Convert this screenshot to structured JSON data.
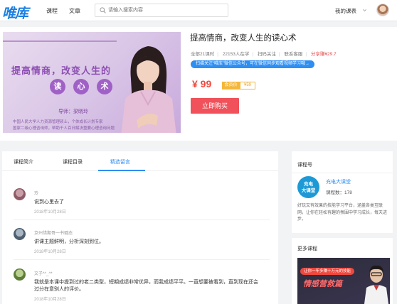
{
  "header": {
    "logo": "唯库",
    "nav": [
      "课程",
      "文章"
    ],
    "search_placeholder": "请输入搜索内容",
    "my_courses": "我的课表"
  },
  "course": {
    "cover": {
      "title_line": "提高情商，改变人生的",
      "circle_chars": [
        "读",
        "心",
        "术"
      ],
      "mentor": "导师：梁晓玲",
      "desc1": "中国人民大学人力资源管理硕士，个体成长计划专家",
      "desc2": "国家二级心理咨询师，帮助千人百日解决重要心理咨询问题"
    },
    "title": "提高情商，改变人生的读心术",
    "meta": {
      "lessons": "全部21课时",
      "learners": "22153人在学",
      "follow": "扫码关注",
      "service": "联系客服",
      "share": "分享赚¥29.7"
    },
    "promo": "扫描关注“唯库”微信公众号，可在微信同步观看视频学习哦→",
    "price": "¥ 99",
    "vip_label": "会员价",
    "vip_price": "¥59",
    "buy_button": "立即购买"
  },
  "tabs": {
    "items": [
      "课程简介",
      "课程目录",
      "精选留言"
    ],
    "active_index": 2
  },
  "comments": [
    {
      "name": "玲",
      "text": "说到心里去了",
      "text2": "",
      "date": "2018年10月28日"
    },
    {
      "name": "京州惜期哥一书璐态",
      "text": "讲课主题鲜明，分析深刻到位。",
      "text2": "",
      "date": "2018年10月28日"
    },
    {
      "name": "文子*^_^*",
      "text": "我就是本课中提到过的老二类型，短期成绩非常优异，而我成绩平平。一直想要被看到，直到现在还会",
      "text2": "过分在意别人的评价。",
      "date": "2018年10月28日"
    }
  ],
  "account": {
    "heading": "课程号",
    "logo_text": [
      "充电",
      "大课堂"
    ],
    "name": "充电大课堂",
    "count": "课程数：178",
    "desc": "好玩又有效果的技能学习平台，涵盖各类互联网，让你在轻松有趣的氛围中学习成长，每天进步。"
  },
  "more": {
    "heading": "更多课程",
    "thumb_pill": "让你一年多赚十万元的技能",
    "thumb_title": "情感营救篇"
  },
  "colors": {
    "accent_blue": "#2f8ef2",
    "price_red": "#f0483e",
    "buy_button": "#f0515a",
    "vip_orange": "#f5b73a",
    "cover_purple": "#a061c6"
  }
}
